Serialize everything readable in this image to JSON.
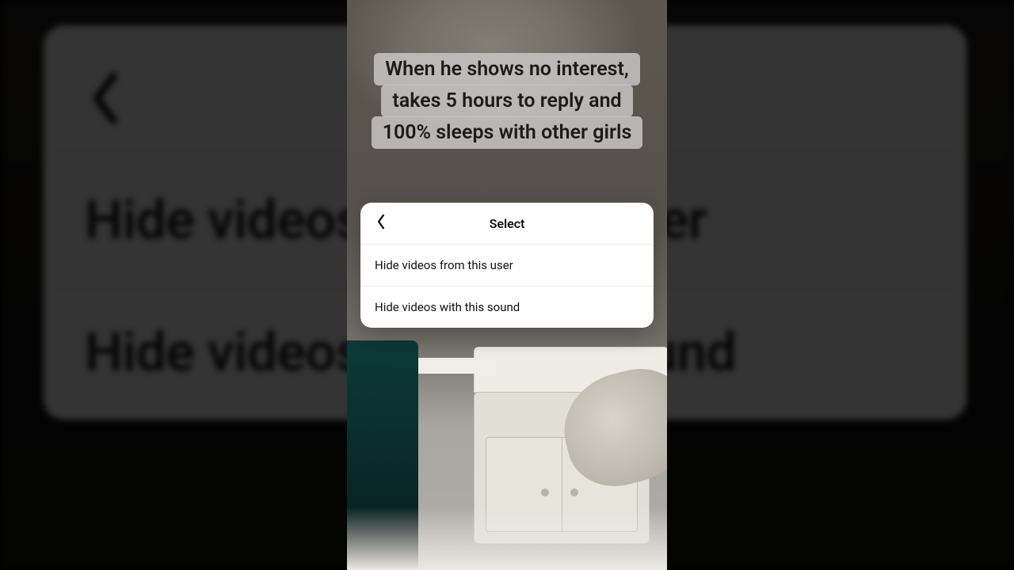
{
  "caption": {
    "text": "When he shows no interest, takes 5 hours to reply and 100% sleeps with other girls"
  },
  "dialog": {
    "title": "Select",
    "back_icon": "chevron-left",
    "options": [
      {
        "label": "Hide videos from this user"
      },
      {
        "label": "Hide videos with this sound"
      }
    ]
  },
  "bg_dialog": {
    "row1": "Hide videos from this user",
    "row2": "Hide videos with this sound"
  }
}
